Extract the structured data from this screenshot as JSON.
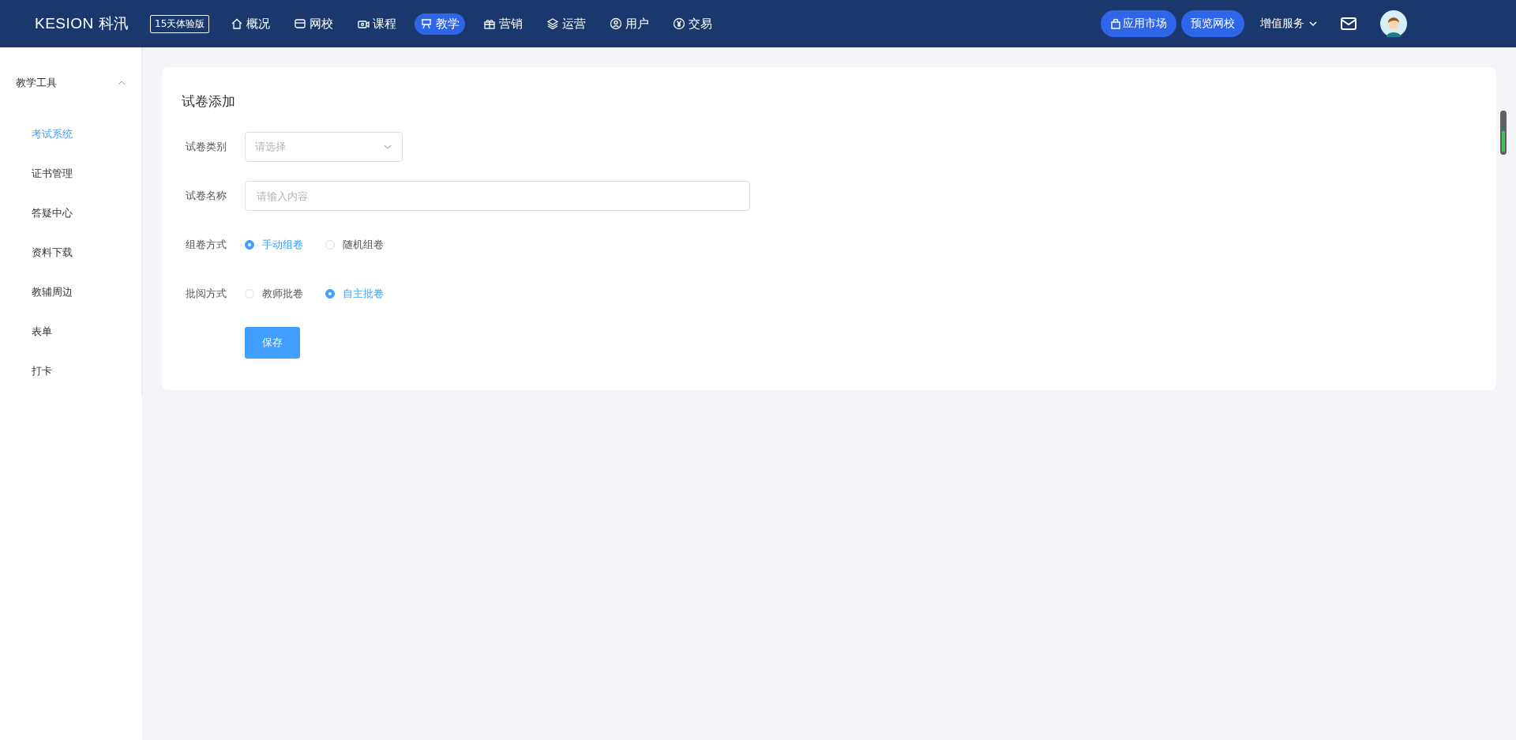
{
  "header": {
    "logo": "KESION 科汛",
    "trial_badge": "15天体验版",
    "nav": [
      {
        "label": "概况",
        "selected": false
      },
      {
        "label": "网校",
        "selected": false
      },
      {
        "label": "课程",
        "selected": false
      },
      {
        "label": "教学",
        "selected": true
      },
      {
        "label": "营销",
        "selected": false
      },
      {
        "label": "运营",
        "selected": false
      },
      {
        "label": "用户",
        "selected": false
      },
      {
        "label": "交易",
        "selected": false
      }
    ],
    "app_market_button": "应用市场",
    "preview_button": "预览网校",
    "services_menu": "增值服务"
  },
  "sidebar": {
    "group": {
      "label": "教学工具",
      "expanded": true
    },
    "items": [
      {
        "label": "考试系统",
        "selected": true
      },
      {
        "label": "证书管理",
        "selected": false
      },
      {
        "label": "答疑中心",
        "selected": false
      },
      {
        "label": "资料下载",
        "selected": false
      },
      {
        "label": "教辅周边",
        "selected": false
      },
      {
        "label": "表单",
        "selected": false
      },
      {
        "label": "打卡",
        "selected": false
      }
    ]
  },
  "form": {
    "title": "试卷添加",
    "fields": [
      {
        "kind": "select",
        "label": "试卷类别",
        "placeholder": "请选择"
      },
      {
        "kind": "input",
        "label": "试卷名称",
        "placeholder": "请输入内容"
      },
      {
        "kind": "radio",
        "label": "组卷方式",
        "options": [
          {
            "label": "手动组卷",
            "selected": true
          },
          {
            "label": "随机组卷",
            "selected": false
          }
        ]
      },
      {
        "kind": "radio",
        "label": "批阅方式",
        "options": [
          {
            "label": "教师批卷",
            "selected": false
          },
          {
            "label": "自主批卷",
            "selected": true
          }
        ]
      }
    ],
    "save_button": "保存"
  }
}
